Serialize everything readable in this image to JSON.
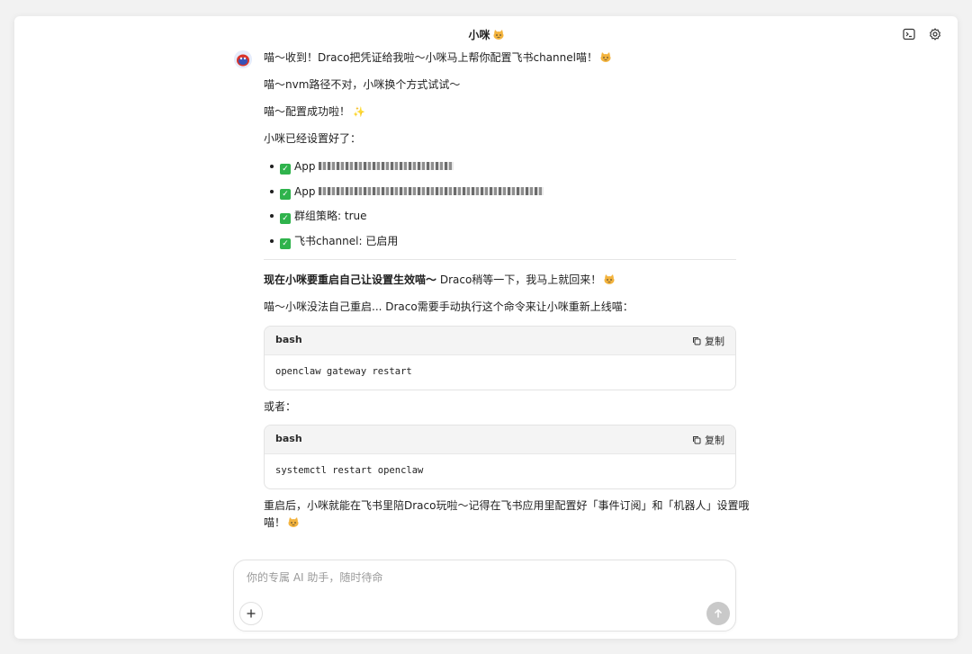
{
  "window": {
    "title": "小咪"
  },
  "topbar": {
    "terminal_icon": "terminal-icon",
    "settings_icon": "gear-icon"
  },
  "messages": {
    "line1": "喵～收到！Draco把凭证给我啦～小咪马上帮你配置飞书channel喵！",
    "line2": "喵～nvm路径不对，小咪换个方式试试～",
    "line3": "喵～配置成功啦！",
    "line4": "小咪已经设置好了：",
    "list": [
      {
        "prefix": "App",
        "value": ""
      },
      {
        "prefix": "App",
        "value": ""
      },
      {
        "prefix": "群组策略: true",
        "value": ""
      },
      {
        "prefix": "飞书channel: 已启用",
        "value": ""
      }
    ],
    "restart_bold": "现在小咪要重启自己让设置生效喵～",
    "restart_rest": " Draco稍等一下，我马上就回来！",
    "manual": "喵～小咪没法自己重启... Draco需要手动执行这个命令来让小咪重新上线喵：",
    "or": "或者：",
    "final1": "重启后，小咪就能在飞书里陪Draco玩啦～记得在飞书应用里配置好「事件订阅」和「机器人」设置哦",
    "final2": "喵！"
  },
  "code_blocks": [
    {
      "lang": "bash",
      "copy_label": "复制",
      "code": "openclaw gateway restart"
    },
    {
      "lang": "bash",
      "copy_label": "复制",
      "code": "systemctl restart openclaw"
    }
  ],
  "composer": {
    "placeholder": "你的专属 AI 助手，随时待命"
  },
  "colors": {
    "check_green": "#2fb34c",
    "send_disabled": "#c9c9c9"
  }
}
